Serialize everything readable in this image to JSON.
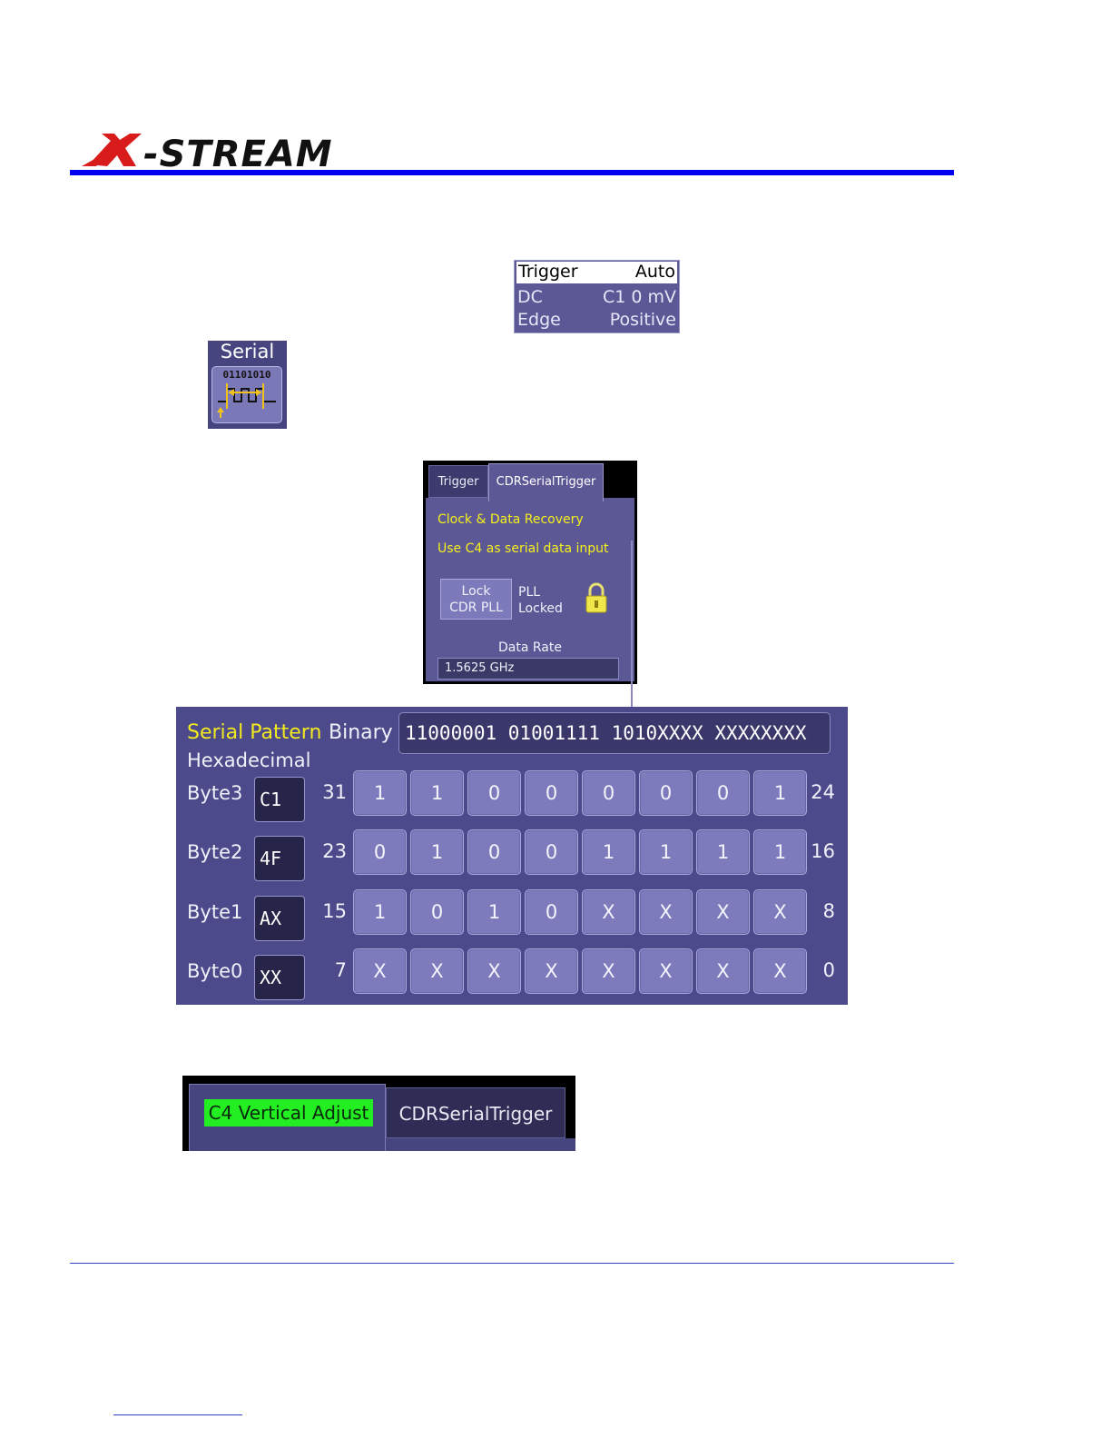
{
  "header": {
    "logo_text": "X-STREAM"
  },
  "trigger_summary": {
    "rows": [
      {
        "left": "Trigger",
        "right": "Auto"
      },
      {
        "left": "DC",
        "right": "C1  0 mV"
      },
      {
        "left": "Edge",
        "right": "Positive"
      }
    ]
  },
  "serial_icon": {
    "label": "Serial",
    "bits": "01101010"
  },
  "cdr_dialog": {
    "tabs": [
      "Trigger",
      "CDRSerialTrigger"
    ],
    "heading": "Clock & Data Recovery",
    "input_note": "Use C4 as serial data input",
    "lock_button": [
      "Lock",
      "CDR PLL"
    ],
    "pll_status": [
      "PLL",
      "Locked"
    ],
    "data_rate_label": "Data Rate",
    "data_rate_value": "1.5625 GHz"
  },
  "serial_pattern": {
    "title": "Serial Pattern",
    "binary_label": "Binary",
    "binary_value": "11000001 01001111 1010XXXX XXXXXXXX",
    "hex_label": "Hexadecimal",
    "bytes": [
      {
        "label": "Byte3",
        "hex": "C1",
        "hi": "31",
        "lo": "24",
        "bits": [
          "1",
          "1",
          "0",
          "0",
          "0",
          "0",
          "0",
          "1"
        ]
      },
      {
        "label": "Byte2",
        "hex": "4F",
        "hi": "23",
        "lo": "16",
        "bits": [
          "0",
          "1",
          "0",
          "0",
          "1",
          "1",
          "1",
          "1"
        ]
      },
      {
        "label": "Byte1",
        "hex": "AX",
        "hi": "15",
        "lo": "8",
        "bits": [
          "1",
          "0",
          "1",
          "0",
          "X",
          "X",
          "X",
          "X"
        ]
      },
      {
        "label": "Byte0",
        "hex": "XX",
        "hi": "7",
        "lo": "0",
        "bits": [
          "X",
          "X",
          "X",
          "X",
          "X",
          "X",
          "X",
          "X"
        ]
      }
    ]
  },
  "bottom_tabs": {
    "active": "C4 Vertical Adjust",
    "inactive": "CDRSerialTrigger"
  },
  "colors": {
    "rule_blue": "#0000ee",
    "panel": "#5c5896",
    "highlight_yellow": "#f2ea1e",
    "active_green": "#22ee22"
  }
}
